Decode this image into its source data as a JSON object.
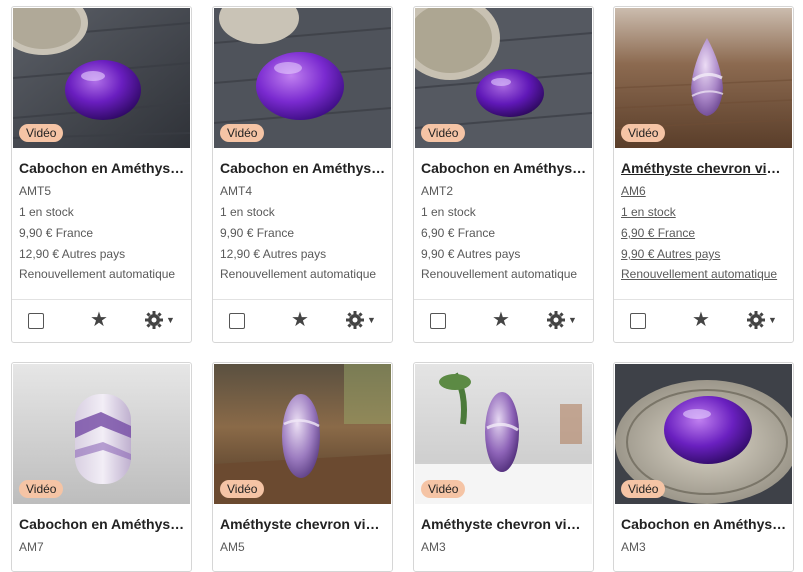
{
  "listings": [
    {
      "title": "Cabochon en Améthyste naturelle",
      "sku": "AMT5",
      "stock": "1 en stock",
      "price_fr": "9,90 € France",
      "price_other": "12,90 € Autres pays",
      "renewal": "Renouvellement automatique",
      "badge": "Vidéo"
    },
    {
      "title": "Cabochon en Améthyste naturelle",
      "sku": "AMT4",
      "stock": "1 en stock",
      "price_fr": "9,90 € France",
      "price_other": "12,90 € Autres pays",
      "renewal": "Renouvellement automatique",
      "badge": "Vidéo"
    },
    {
      "title": "Cabochon en Améthyste naturelle",
      "sku": "AMT2",
      "stock": "1 en stock",
      "price_fr": "6,90 € France",
      "price_other": "9,90 € Autres pays",
      "renewal": "Renouvellement automatique",
      "badge": "Vidéo"
    },
    {
      "title": "Améthyste chevron violette",
      "sku": "AM6",
      "stock": "1 en stock",
      "price_fr": "6,90 € France",
      "price_other": "9,90 € Autres pays",
      "renewal": "Renouvellement automatique",
      "badge": "Vidéo"
    },
    {
      "title": "Cabochon en Améthyste chevron",
      "sku": "AM7",
      "badge": "Vidéo"
    },
    {
      "title": "Améthyste chevron violette",
      "sku": "AM5",
      "badge": "Vidéo"
    },
    {
      "title": "Améthyste chevron violette",
      "sku": "AM3",
      "badge": "Vidéo"
    },
    {
      "title": "Cabochon en Améthyste naturelle",
      "sku": "AM3",
      "badge": "Vidéo"
    }
  ],
  "icons": {
    "select": "checkbox-icon",
    "favorite": "star-icon",
    "settings": "gear-icon",
    "menu": "caret-down-icon"
  },
  "colors": {
    "badge_bg": "#f5c4a5",
    "border": "#d6d6d6",
    "text_muted": "#595959"
  }
}
